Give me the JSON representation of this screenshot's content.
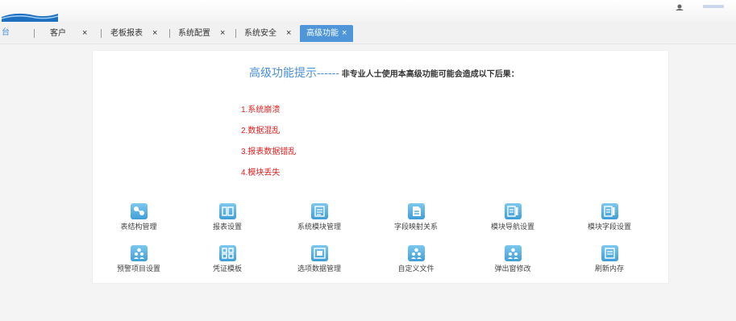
{
  "tabs": [
    {
      "label": "台",
      "closable": false
    },
    {
      "label": "客户",
      "closable": true
    },
    {
      "label": "老板报表",
      "closable": true
    },
    {
      "label": "系统配置",
      "closable": true
    },
    {
      "label": "系统安全",
      "closable": true
    },
    {
      "label": "高级功能",
      "closable": true,
      "active": true
    }
  ],
  "close_glyph": "×",
  "heading": {
    "title": "高级功能提示------",
    "subtitle": "非专业人士使用本高级功能可能会造成以下后果："
  },
  "warnings": [
    "1.系统崩溃",
    "2.数据混乱",
    "3.报表数据错乱",
    "4.模块丢失"
  ],
  "functions_row1": [
    {
      "label": "表结构管理",
      "icon": "table-structure-icon"
    },
    {
      "label": "报表设置",
      "icon": "report-settings-icon"
    },
    {
      "label": "系统模块管理",
      "icon": "system-module-icon"
    },
    {
      "label": "字段映射关系",
      "icon": "field-mapping-icon"
    },
    {
      "label": "模块导航设置",
      "icon": "module-nav-icon"
    },
    {
      "label": "模块字段设置",
      "icon": "module-field-icon"
    }
  ],
  "functions_row2": [
    {
      "label": "预警项目设置",
      "icon": "users-icon"
    },
    {
      "label": "凭证模板",
      "icon": "voucher-template-icon"
    },
    {
      "label": "选项数据管理",
      "icon": "option-data-icon"
    },
    {
      "label": "自定义文件",
      "icon": "users-icon"
    },
    {
      "label": "弹出窗修改",
      "icon": "users-icon"
    },
    {
      "label": "刷新内存",
      "icon": "refresh-memory-icon"
    }
  ],
  "colors": {
    "accent": "#4e95da",
    "warning": "#e02020",
    "icon": "#3f9ed7"
  }
}
